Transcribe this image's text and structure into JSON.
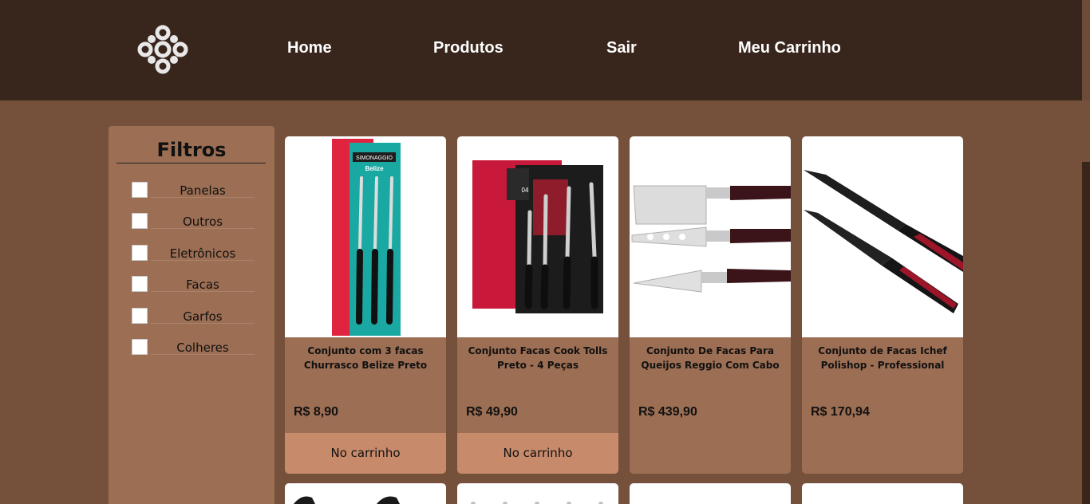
{
  "nav": {
    "home": "Home",
    "produtos": "Produtos",
    "sair": "Sair",
    "carrinho": "Meu Carrinho"
  },
  "filters": {
    "title": "Filtros",
    "items": [
      {
        "label": "Panelas",
        "checked": false
      },
      {
        "label": "Outros",
        "checked": false
      },
      {
        "label": "Eletrônicos",
        "checked": false
      },
      {
        "label": "Facas",
        "checked": false
      },
      {
        "label": "Garfos",
        "checked": false
      },
      {
        "label": "Colheres",
        "checked": false
      }
    ]
  },
  "products": [
    {
      "title": "Conjunto com 3 facas Churrasco Belize Preto",
      "price": "R$ 8,90",
      "button": "No carrinho",
      "image_icon": "knife-set-pack-icon",
      "brand": "SIMONAGGIO",
      "model": "Belize"
    },
    {
      "title": "Conjunto Facas Cook Tolls Preto - 4 Peças",
      "price": "R$ 49,90",
      "button": "No carrinho",
      "image_icon": "knife-set-box-icon",
      "badge": "04"
    },
    {
      "title": "Conjunto De Facas Para Queijos Reggio Com Cabo E...",
      "price": "R$ 439,90",
      "button": "",
      "image_icon": "cheese-knives-icon"
    },
    {
      "title": "Conjunto de Facas Ichef Polishop - Professional Cut -...",
      "price": "R$ 170,94",
      "button": "",
      "image_icon": "chef-knives-icon"
    }
  ],
  "colors": {
    "header": "#38261c",
    "background": "#75513c",
    "panel": "#9c6e53",
    "cart_button": "#c78a6b"
  }
}
